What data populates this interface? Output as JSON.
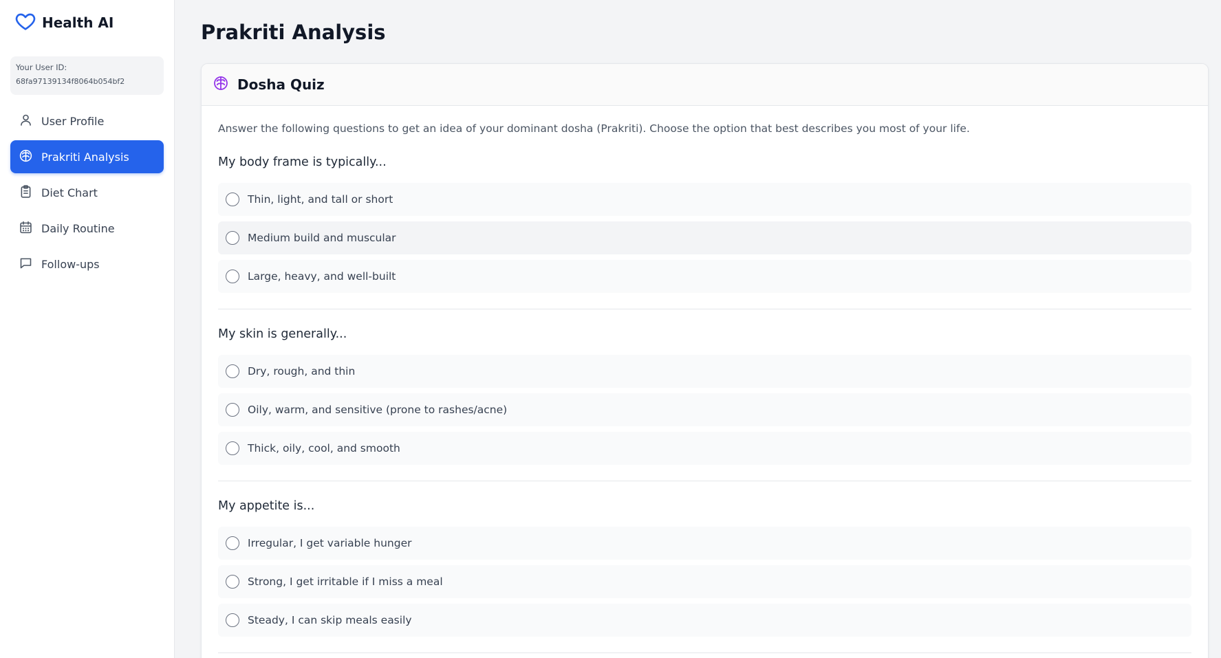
{
  "brand": {
    "name": "Health AI",
    "icon": "heart-icon",
    "accent": "#2563eb"
  },
  "user": {
    "label": "Your User ID:",
    "id": "68fa97139134f8064b054bf2"
  },
  "nav": {
    "items": [
      {
        "label": "User Profile",
        "icon": "user-icon",
        "active": false
      },
      {
        "label": "Prakriti Analysis",
        "icon": "brain-icon",
        "active": true
      },
      {
        "label": "Diet Chart",
        "icon": "clipboard-icon",
        "active": false
      },
      {
        "label": "Daily Routine",
        "icon": "calendar-icon",
        "active": false
      },
      {
        "label": "Follow-ups",
        "icon": "message-icon",
        "active": false
      }
    ]
  },
  "page": {
    "title": "Prakriti Analysis"
  },
  "quiz": {
    "title": "Dosha Quiz",
    "icon": "brain-icon",
    "intro": "Answer the following questions to get an idea of your dominant dosha (Prakriti). Choose the option that best describes you most of your life.",
    "questions": [
      {
        "text": "My body frame is typically...",
        "options": [
          "Thin, light, and tall or short",
          "Medium build and muscular",
          "Large, heavy, and well-built"
        ]
      },
      {
        "text": "My skin is generally...",
        "options": [
          "Dry, rough, and thin",
          "Oily, warm, and sensitive (prone to rashes/acne)",
          "Thick, oily, cool, and smooth"
        ]
      },
      {
        "text": "My appetite is...",
        "options": [
          "Irregular, I get variable hunger",
          "Strong, I get irritable if I miss a meal",
          "Steady, I can skip meals easily"
        ]
      }
    ]
  }
}
